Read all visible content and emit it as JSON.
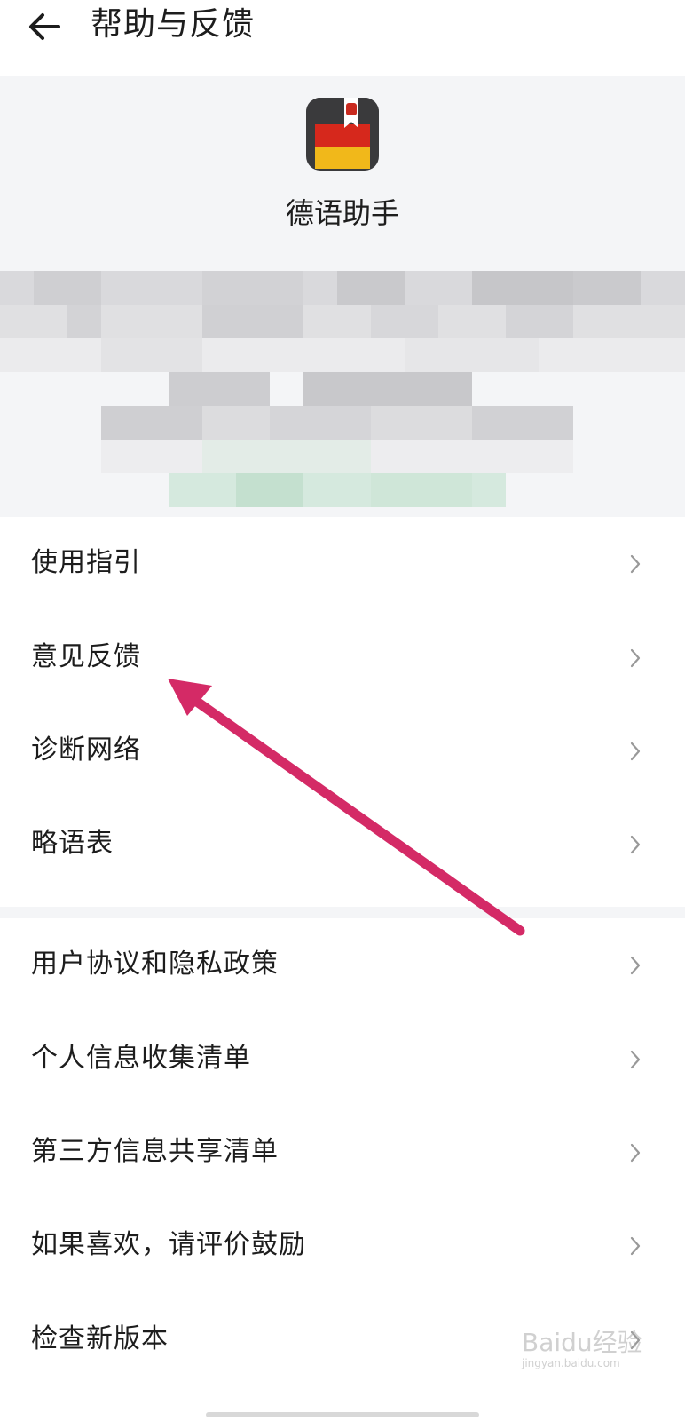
{
  "header": {
    "title": "帮助与反馈"
  },
  "app": {
    "name": "德语助手"
  },
  "menu_group_1": [
    {
      "label": "使用指引"
    },
    {
      "label": "意见反馈"
    },
    {
      "label": "诊断网络"
    },
    {
      "label": "略语表"
    }
  ],
  "menu_group_2": [
    {
      "label": "用户协议和隐私政策"
    },
    {
      "label": "个人信息收集清单"
    },
    {
      "label": "第三方信息共享清单"
    },
    {
      "label": "如果喜欢，请评价鼓励"
    },
    {
      "label": "检查新版本"
    }
  ],
  "annotation": {
    "arrow_color": "#d42a66"
  },
  "watermark": {
    "text": "Baidu经验",
    "sub": "jingyan.baidu.com"
  }
}
